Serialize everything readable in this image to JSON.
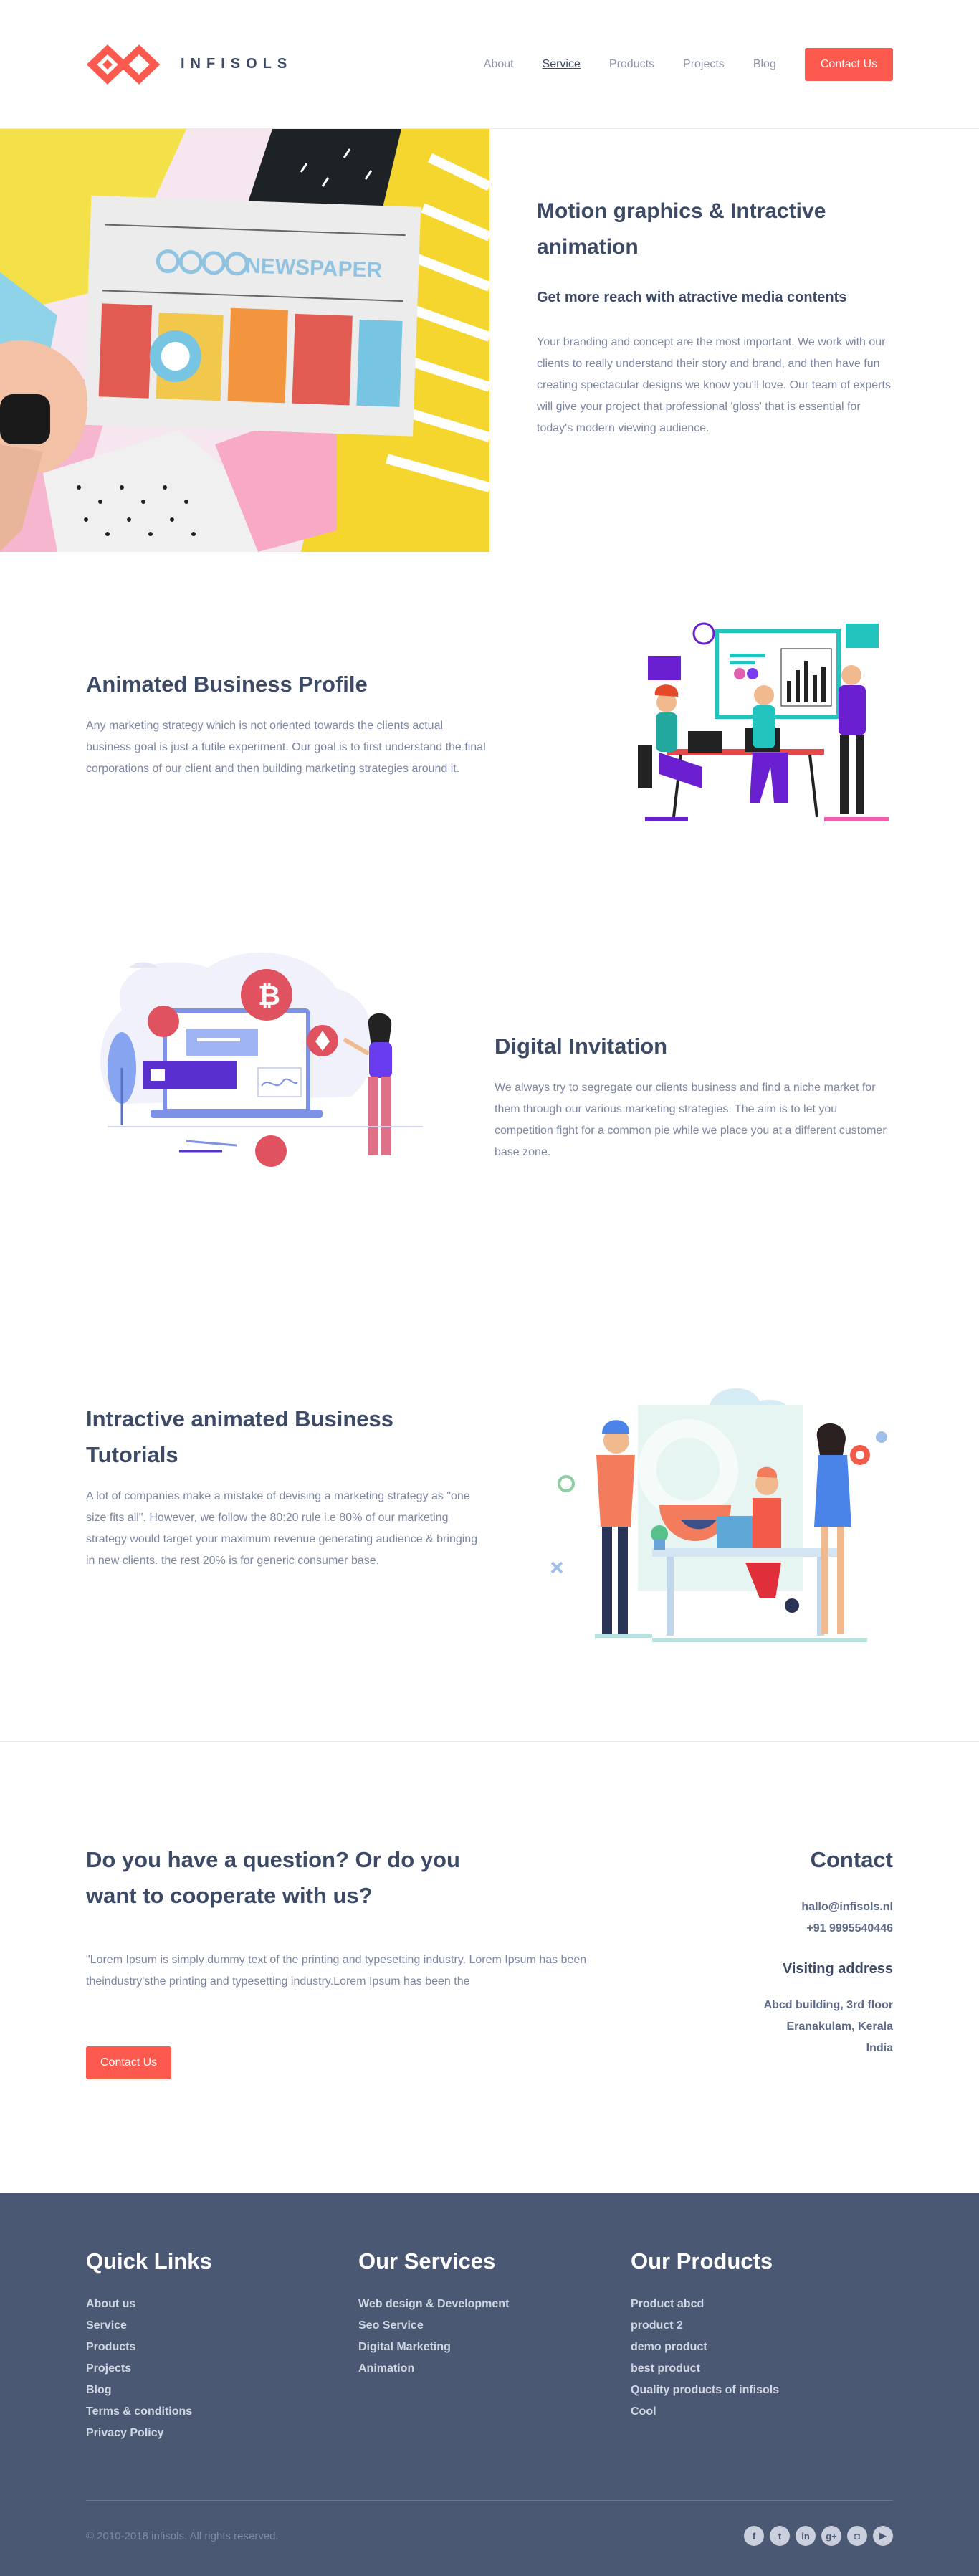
{
  "brand": {
    "name": "INFISOLS",
    "accent": "#fd5a4f"
  },
  "nav": {
    "items": [
      {
        "label": "About",
        "active": false
      },
      {
        "label": "Service",
        "active": true
      },
      {
        "label": "Products",
        "active": false
      },
      {
        "label": "Projects",
        "active": false
      },
      {
        "label": "Blog",
        "active": false
      }
    ],
    "cta": "Contact Us"
  },
  "hero": {
    "title": "Motion graphics & Intractive animation",
    "subtitle": "Get more reach with atractive media contents",
    "description": "Your branding and concept are the most important. We work with our clients to really understand their story and brand, and then have fun creating spectacular designs we know you'll love. Our team of experts will give your project that professional 'gloss' that is essential for today's modern viewing audience.",
    "image_text": "NEWSPAPER"
  },
  "features": [
    {
      "title": "Animated Business Profile",
      "description": "Any marketing strategy which is not oriented towards the clients actual business goal is just a futile experiment. Our goal is to first understand the final corporations of our client and then building marketing strategies around it."
    },
    {
      "title": "Digital Invitation",
      "description": "We always try to segregate our clients business and find a niche market for them through our various marketing strategies. The aim is to let you competition fight for a common pie while we place you at a different customer base zone."
    },
    {
      "title": "Intractive animated Business Tutorials",
      "description": "A lot of companies make a mistake of devising a marketing strategy as \"one size fits all\". However, we follow the 80:20 rule i.e 80% of our marketing strategy would target your maximum revenue generating audience & bringing in new clients. the rest 20% is for generic consumer base."
    }
  ],
  "contact": {
    "question_title": "Do you have a question? Or do you want to cooperate with us?",
    "question_desc": "\"Lorem Ipsum is simply dummy text of the printing and typesetting industry. Lorem Ipsum has been theindustry'sthe printing and typesetting industry.Lorem Ipsum has been the",
    "button": "Contact Us",
    "title": "Contact",
    "email": "hallo@infisols.nl",
    "phone": "+91  9995540446",
    "address_title": "Visiting address",
    "address_lines": [
      "Abcd building, 3rd floor",
      "Eranakulam, Kerala",
      "India"
    ]
  },
  "footer": {
    "quick_links": {
      "title": "Quick Links",
      "items": [
        "About us",
        "Service",
        "Products",
        "Projects",
        "Blog",
        "Terms & conditions",
        "Privacy Policy"
      ]
    },
    "services": {
      "title": "Our Services",
      "items": [
        "Web design & Development",
        "Seo Service",
        "Digital Marketing",
        "Animation"
      ]
    },
    "products": {
      "title": "Our Products",
      "items": [
        "Product abcd",
        "product 2",
        "demo product",
        "best product",
        "Quality products of infisols",
        "Cool"
      ]
    },
    "copyright": "©  2010-2018 infisols. All rights reserved.",
    "socials": [
      {
        "name": "facebook-icon",
        "glyph": "f"
      },
      {
        "name": "twitter-icon",
        "glyph": "t"
      },
      {
        "name": "linkedin-icon",
        "glyph": "in"
      },
      {
        "name": "google-plus-icon",
        "glyph": "g+"
      },
      {
        "name": "instagram-icon",
        "glyph": "◘"
      },
      {
        "name": "youtube-icon",
        "glyph": "▶"
      }
    ]
  }
}
